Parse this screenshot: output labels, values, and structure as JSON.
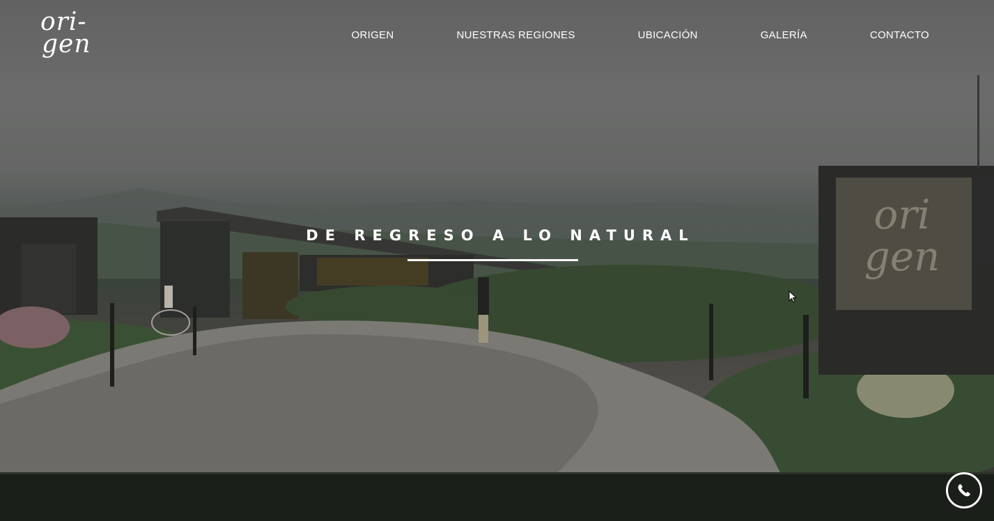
{
  "logo": {
    "line1": "ori-",
    "line2": "gen"
  },
  "nav": {
    "items": [
      {
        "label": "ORIGEN"
      },
      {
        "label": "NUESTRAS REGIONES"
      },
      {
        "label": "UBICACIÓN"
      },
      {
        "label": "GALERÍA"
      },
      {
        "label": "CONTACTO"
      }
    ]
  },
  "hero": {
    "tagline": "DE REGRESO A LO NATURAL",
    "sign_text_line1": "ori",
    "sign_text_line2": "gen"
  },
  "whatsapp": {
    "icon": "whatsapp-icon"
  },
  "colors": {
    "footer": "#1a2019",
    "text": "#ffffff"
  }
}
